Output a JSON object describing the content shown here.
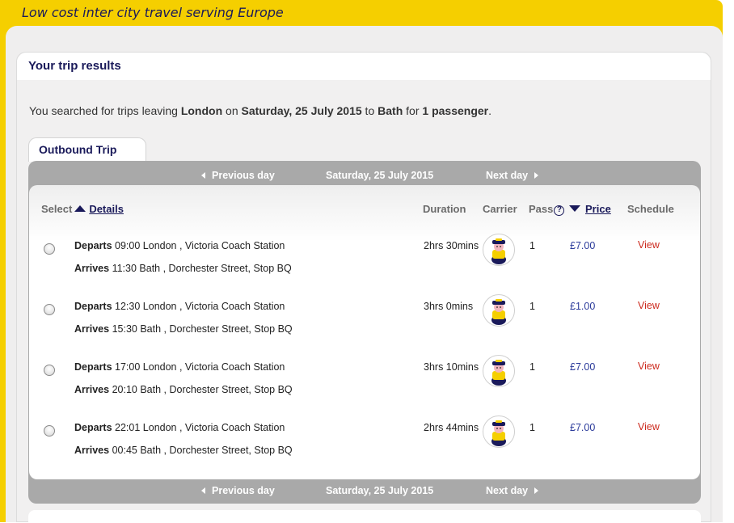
{
  "header": {
    "tagline": "Low cost inter city travel serving Europe"
  },
  "results": {
    "title": "Your trip results",
    "summary": {
      "prefix": "You searched for trips leaving ",
      "origin": "London",
      "on": " on ",
      "date": "Saturday, 25 July 2015",
      "to": " to ",
      "destination": "Bath",
      "for": " for ",
      "passengers": "1 passenger",
      "suffix": "."
    }
  },
  "tab": {
    "label": "Outbound Trip"
  },
  "nav": {
    "prev_label": "Previous day",
    "date_label": "Saturday, 25 July 2015",
    "next_label": "Next day"
  },
  "columns": {
    "select": "Select",
    "details": "Details",
    "duration": "Duration",
    "carrier": "Carrier",
    "pass": "Pass",
    "price": "Price",
    "schedule": "Schedule"
  },
  "trips": [
    {
      "depart_label": "Departs",
      "depart_time": "09:00",
      "depart_place": "London , Victoria Coach Station",
      "arrive_label": "Arrives",
      "arrive_time": "11:30",
      "arrive_place": "Bath , Dorchester Street, Stop BQ",
      "duration": "2hrs 30mins",
      "pass": "1",
      "price": "£7.00",
      "view": "View"
    },
    {
      "depart_label": "Departs",
      "depart_time": "12:30",
      "depart_place": "London , Victoria Coach Station",
      "arrive_label": "Arrives",
      "arrive_time": "15:30",
      "arrive_place": "Bath , Dorchester Street, Stop BQ",
      "duration": "3hrs 0mins",
      "pass": "1",
      "price": "£1.00",
      "view": "View"
    },
    {
      "depart_label": "Departs",
      "depart_time": "17:00",
      "depart_place": "London , Victoria Coach Station",
      "arrive_label": "Arrives",
      "arrive_time": "20:10",
      "arrive_place": "Bath , Dorchester Street, Stop BQ",
      "duration": "3hrs 10mins",
      "pass": "1",
      "price": "£7.00",
      "view": "View"
    },
    {
      "depart_label": "Departs",
      "depart_time": "22:01",
      "depart_place": "London , Victoria Coach Station",
      "arrive_label": "Arrives",
      "arrive_time": "00:45",
      "arrive_place": "Bath , Dorchester Street, Stop BQ",
      "duration": "2hrs 44mins",
      "pass": "1",
      "price": "£7.00",
      "view": "View"
    }
  ],
  "icons": {
    "carrier": "coach-mascot-icon",
    "help": "help-icon",
    "sort_up": "sort-ascending-icon",
    "sort_down": "sort-descending-icon"
  },
  "colors": {
    "brand_yellow": "#f5cf00",
    "navy": "#1a1a5a",
    "view_red": "#cc2a1e",
    "price_blue": "#2a3a9a"
  }
}
